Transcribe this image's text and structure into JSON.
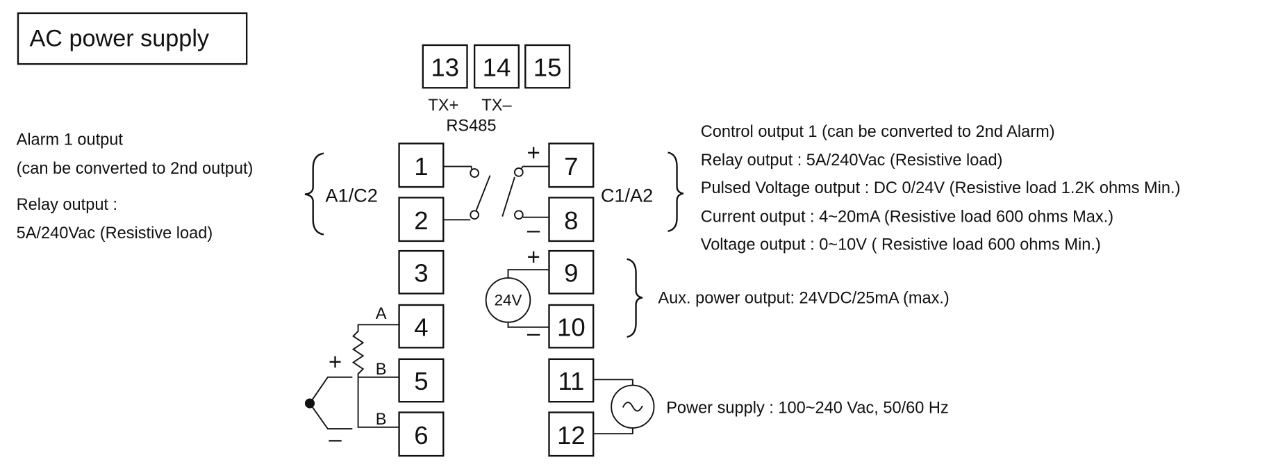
{
  "title": "AC power supply",
  "terminals": {
    "t1": "1",
    "t2": "2",
    "t3": "3",
    "t4": "4",
    "t5": "5",
    "t6": "6",
    "t7": "7",
    "t8": "8",
    "t9": "9",
    "t10": "10",
    "t11": "11",
    "t12": "12",
    "t13": "13",
    "t14": "14",
    "t15": "15"
  },
  "rs485": {
    "tx_plus": "TX+",
    "tx_minus": "TX–",
    "label": "RS485"
  },
  "alarm": {
    "lines": [
      "Alarm 1 output",
      "(can be converted to 2nd output)",
      "Relay output :",
      "5A/240Vac (Resistive load)"
    ],
    "group": "A1/C2"
  },
  "control": {
    "group": "C1/A2",
    "lines": [
      "Control output 1 (can be converted to 2nd Alarm)",
      "Relay output : 5A/240Vac (Resistive load)",
      "Pulsed Voltage output : DC 0/24V (Resistive load 1.2K ohms Min.)",
      "Current output : 4~20mA (Resistive load 600 ohms Max.)",
      "Voltage output : 0~10V ( Resistive load 600 ohms Min.)"
    ]
  },
  "aux": {
    "source": "24V",
    "text": "Aux. power output: 24VDC/25mA (max.)"
  },
  "sensor": {
    "a": "A",
    "b1": "B",
    "b2": "B"
  },
  "polarity": {
    "plus": "+",
    "minus": "–"
  },
  "power": {
    "text": "Power supply : 100~240 Vac, 50/60 Hz",
    "symbol": "~"
  }
}
